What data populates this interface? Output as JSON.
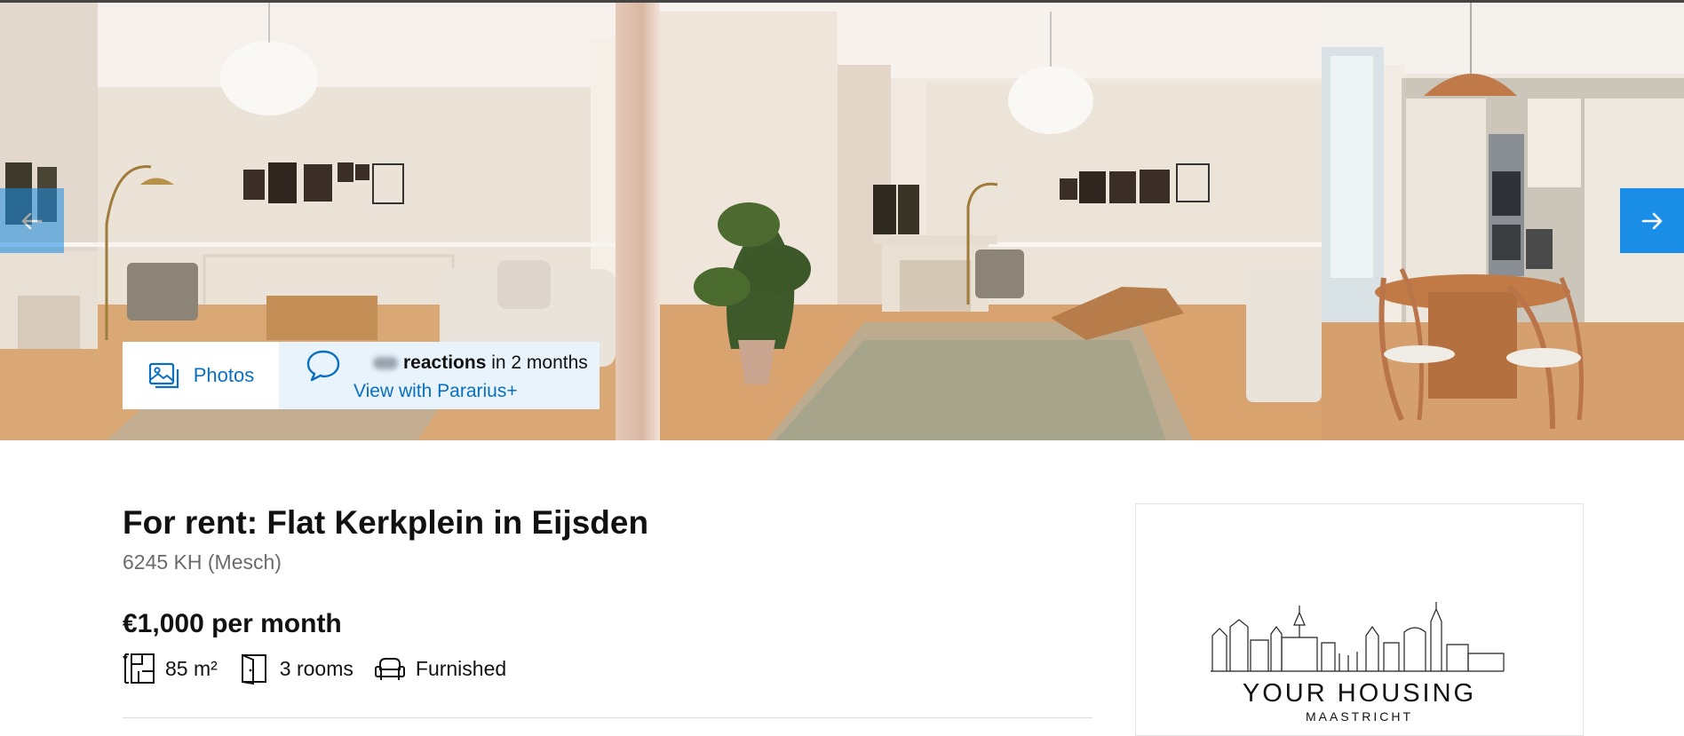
{
  "gallery": {
    "photos_label": "Photos",
    "reactions_count": "",
    "reactions_label": "reactions",
    "reactions_period": " in 2 months",
    "pararius_cta": "View with Pararius+"
  },
  "listing": {
    "title": "For rent: Flat Kerkplein in Eijsden",
    "address": "6245 KH (Mesch)",
    "price": "€1,000 per month",
    "features": [
      {
        "icon": "surface-area-icon",
        "label": "85 m²"
      },
      {
        "icon": "rooms-icon",
        "label": "3 rooms"
      },
      {
        "icon": "furnished-icon",
        "label": "Furnished"
      }
    ]
  },
  "agent": {
    "name": "YOUR HOUSING",
    "city": "MAASTRICHT"
  },
  "colors": {
    "accent": "#1a8ee6",
    "link": "#0a6fc1",
    "reactions_bg": "#e8f3fc"
  }
}
